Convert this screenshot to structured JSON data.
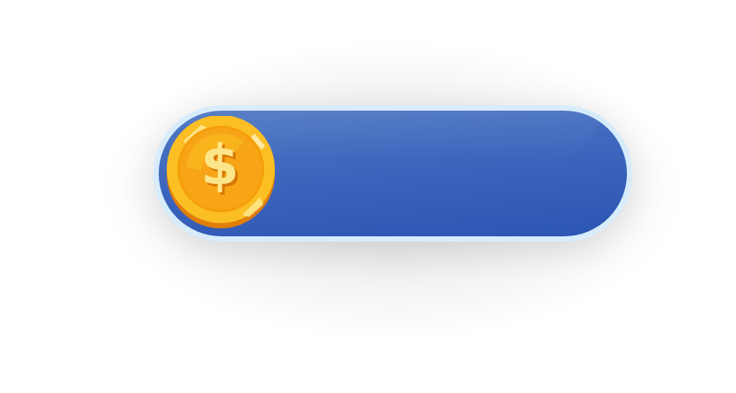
{
  "hud": {
    "currency_icon": "gold-dollar-coin-icon",
    "amount": "",
    "colors": {
      "bar_fill": "#3d66bd",
      "bar_border": "#d7ecfb",
      "coin_gold": "#f7a516",
      "coin_rim": "#fcd34d"
    }
  }
}
